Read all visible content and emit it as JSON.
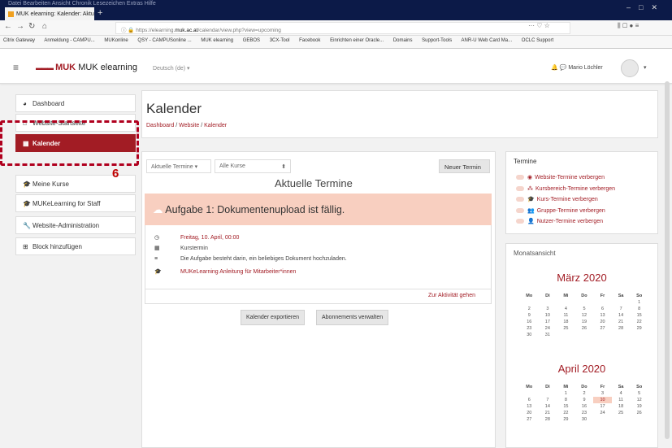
{
  "browser": {
    "menu": "Datei  Bearbeiten  Ansicht  Chronik  Lesezeichen  Extras  Hilfe",
    "tab_title": "MUK elearning: Kalender: Aktu",
    "url_prefix": "https://elearning.",
    "url_domain": "muk.ac.at",
    "url_path": "/calendar/view.php?view=upcoming",
    "bookmarks": [
      "Citrix Gateway",
      "Anmeldung - CAMPU...",
      "MUKonline",
      "QSY - CAMPUSonline ...",
      "MUK elearning",
      "GEBOS",
      "3CX-Tool",
      "Facebook",
      "Einrichten einer Oracle...",
      "Domains",
      "Support-Tools",
      "ANR-U Web Card Ma...",
      "OCLC Support"
    ]
  },
  "header": {
    "logo_short": "MUK",
    "logo_text": "MUK elearning",
    "language": "Deutsch (de)",
    "user": "Mario Löchler"
  },
  "sidebar": {
    "items": [
      "Dashboard",
      "Website-Startseite",
      "Kalender",
      "Meine Kurse",
      "MUKeLearning for Staff",
      "Website-Administration",
      "Block hinzufügen"
    ]
  },
  "annotation": {
    "number": "6"
  },
  "page": {
    "title": "Kalender",
    "crumb_home": "Dashboard",
    "crumb_site": "Website",
    "crumb_current": "Kalender"
  },
  "main": {
    "filter_view": "Aktuelle Termine",
    "filter_course": "Alle Kurse",
    "new_button": "Neuer Termin",
    "heading": "Aktuelle Termine",
    "event": {
      "title": "Aufgabe 1: Dokumentenupload ist fällig.",
      "date": "Freitag, 10. April, 00:00",
      "type": "Kurstermin",
      "description": "Die Aufgabe besteht darin, ein beliebiges Dokument hochzuladen.",
      "course": "MUKeLearning Anleitung für Mitarbeiter*innen",
      "link": "Zur Aktivität gehen"
    },
    "export_button": "Kalender exportieren",
    "subscriptions_button": "Abonnements verwalten"
  },
  "termine": {
    "title": "Termine",
    "items": [
      "Website-Termine verbergen",
      "Kursbereich-Termine verbergen",
      "Kurs-Termine verbergen",
      "Gruppe-Termine verbergen",
      "Nutzer-Termine verbergen"
    ]
  },
  "monatsansicht": {
    "title": "Monatsansicht",
    "weekdays": [
      "Mo",
      "Di",
      "Mi",
      "Do",
      "Fr",
      "Sa",
      "So"
    ],
    "months": [
      {
        "name": "März 2020",
        "weeks": [
          [
            "",
            "",
            "",
            "",
            "",
            "",
            "1"
          ],
          [
            "2",
            "3",
            "4",
            "5",
            "6",
            "7",
            "8"
          ],
          [
            "9",
            "10",
            "11",
            "12",
            "13",
            "14",
            "15"
          ],
          [
            "16",
            "17",
            "18",
            "19",
            "20",
            "21",
            "22"
          ],
          [
            "23",
            "24",
            "25",
            "26",
            "27",
            "28",
            "29"
          ],
          [
            "30",
            "31",
            "",
            "",
            "",
            "",
            ""
          ]
        ]
      },
      {
        "name": "April 2020",
        "weeks": [
          [
            "",
            "",
            "1",
            "2",
            "3",
            "4",
            "5"
          ],
          [
            "6",
            "7",
            "8",
            "9",
            "10",
            "11",
            "12"
          ],
          [
            "13",
            "14",
            "15",
            "16",
            "17",
            "18",
            "19"
          ],
          [
            "20",
            "21",
            "22",
            "23",
            "24",
            "25",
            "26"
          ],
          [
            "27",
            "28",
            "29",
            "30",
            "",
            "",
            ""
          ]
        ],
        "highlight": "10"
      }
    ]
  },
  "colors": {
    "brand": "#a21c24",
    "annotation": "#c00000",
    "event_header": "#f8cfc0",
    "titlebar": "#0c1a48"
  }
}
